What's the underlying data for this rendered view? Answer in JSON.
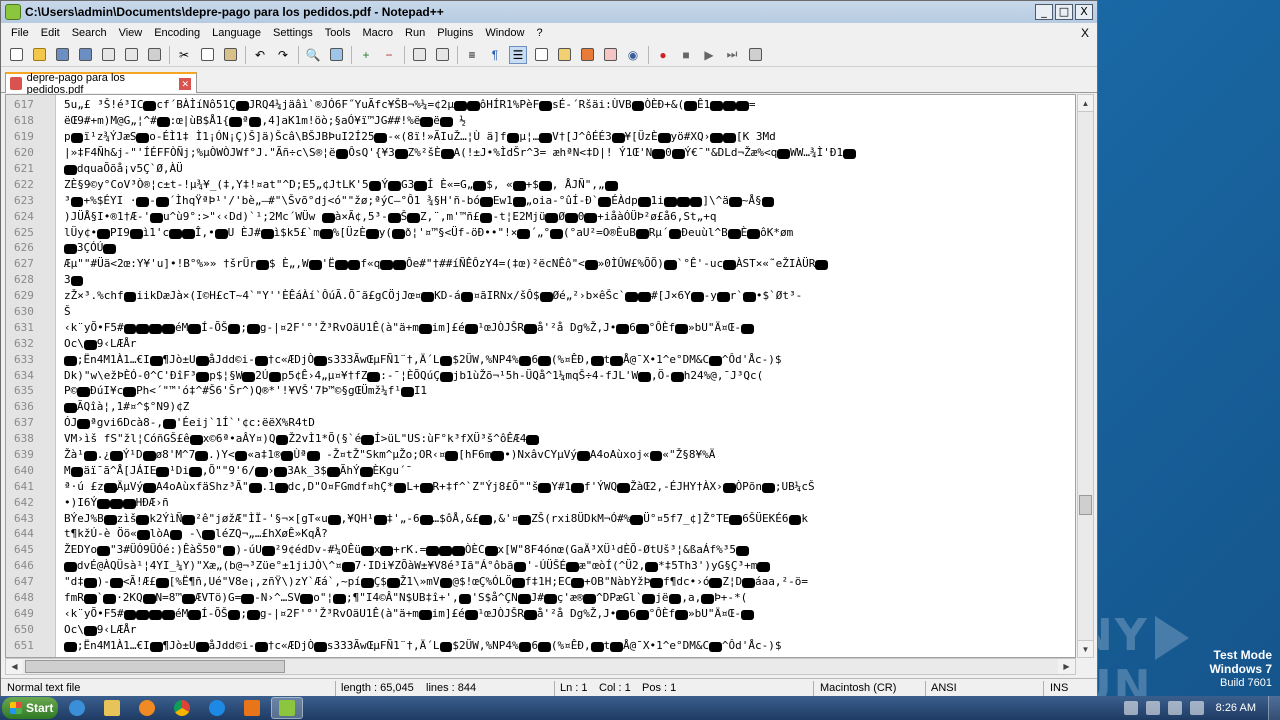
{
  "window": {
    "title": "C:\\Users\\admin\\Documents\\depre-pago para los pedidos.pdf - Notepad++",
    "minimize_glyph": "_",
    "maximize_glyph": "□",
    "close_glyph": "X"
  },
  "menu": {
    "items": [
      "File",
      "Edit",
      "Search",
      "View",
      "Encoding",
      "Language",
      "Settings",
      "Tools",
      "Macro",
      "Run",
      "Plugins",
      "Window",
      "?"
    ],
    "close_label": "X"
  },
  "toolbar": {
    "icons": [
      "new-file-icon",
      "open-file-icon",
      "save-icon",
      "save-all-icon",
      "close-icon",
      "close-all-icon",
      "print-icon",
      "cut-icon",
      "copy-icon",
      "paste-icon",
      "undo-icon",
      "redo-icon",
      "find-icon",
      "replace-icon",
      "zoom-in-icon",
      "zoom-out-icon",
      "sync-v-icon",
      "sync-h-icon",
      "word-wrap-icon",
      "show-all-chars-icon",
      "indent-guide-icon",
      "udl-icon",
      "doc-map-icon",
      "function-list-icon",
      "folder-workspace-icon",
      "monitor-icon",
      "record-macro-icon",
      "stop-macro-icon",
      "play-macro-icon",
      "play-multiple-icon",
      "save-macro-icon"
    ]
  },
  "tab": {
    "label": "depre-pago para los pedidos.pdf"
  },
  "editor": {
    "lines": [
      {
        "n": "617",
        "text": "5u„£ ³Š!é³IC▮cf´BÀÌíNô51Ç▮JRQ4¼jäâì`®JÓ6F˝YuÃfc¥ŠB¬%¼=¢2µ▮▮ôHÍR1%PèF▮sÉ-´Ršäi:ÙVB▮ÒÈÐ+&(▮Ê1▮▮▮="
      },
      {
        "n": "618",
        "text": "ëŒ9#+m)M@G„¦^#▮:œ|ùB$Å1{▮ª▮,4]aK1m!öò;§aÓ¥ï™JG##!%ë▮ë▮ ½"
      },
      {
        "n": "619",
        "text": "p▮ï¹z¾ÝJæS▮o-ÉÌ1‡ Ì1¡ÓN¡Ç)Š]ä)Šcâ\\BŠJBÞuI2Í25▮-«(8ï!»ÃIuŽ…¦Ù ä]f▮µ¦…▮V†[J^ôÉÉ3▮¥[ÜzÈ▮yö#XQ›▮▮[K 3Md"
      },
      {
        "n": "620",
        "text": "|»‡F4Ñh&j-\"'ÍÉFFÒÑj;%µÒWÒJWf°J.\"Ãñ÷c\\S®¦ë▮ÔsQ'{¥3▮Z%²šÈ▮A(!±J•%ÌdŠr^3= æhªN<‡D|! Ý1Œ'N▮0▮Ý€¯\"&DLd¬Žæ%<q▮WW…¾Ì'Ð1▮"
      },
      {
        "n": "621",
        "text": "▮dquaÕõå¡v5Ç`Ø,ÀÜ"
      },
      {
        "n": "622",
        "text": "ZÈ§9©y°CoV³Ò®¦c±t-!µ¾¥_(‡,Y‡!¤at\"^D;E5„¢JtLK'5▮Ý▮G3▮Í   È«=G„▮$, «▮+$▮, ÅJÑ\",„▮"
      },
      {
        "n": "623",
        "text": "³▮+%$ÉYI ·▮-▮´ÌhqŸªÞ¹'/'bè„—#\"\\Švõ°dj<ó\"\"žø;ªýC—°Ô1 ¾§H'ñ-bó▮Ew1▮„oia-°ûÍ-Ð`▮ÉÀdp▮1i▮▮▮]\\^ä▮~Å§▮"
      },
      {
        "n": "624",
        "text": ")JÜÅ§I•®1†Æ-'▮u^ù9°:>\"‹‹Dd)`¹;2Mc´WÜw ▮à×Ã¢,5³-▮Š▮Z,¨,m'™ñ£▮-t¦E2Mjü▮Ø▮0▮+iåàÓÜÞ²ø£å6,St„+q"
      },
      {
        "n": "625",
        "text": "lÜy¢•▮PI9▮ì1'c▮▮Î,•▮U   ЀJ#▮ì$k5£`m▮%[ÜzÈ▮y(▮ð¦'¤™§<Üf-öÐ••\"!×▮´„°▮(°aU²=O®ÈuB▮Rµ´▮Ðeuùl^B▮È▮ôK*øm"
      },
      {
        "n": "626",
        "text": "▮3ÇÓÚ▮"
      },
      {
        "n": "627",
        "text": "Æµ\"\"#Üä<2œ:Y¥'u]•!B°%»» †šrÜr▮$ È„,W▮'Ë▮▮f«q▮▮Ôe#\"†##íÑÊÔzY4=(‡œ)²ëcNÊô\"<▮»0ÌÛW£%ÕÕ)▮`°Ê'-uc▮ÀST×«˜eŽIÀÜR▮"
      },
      {
        "n": "628",
        "text": "3▮"
      },
      {
        "n": "629",
        "text": "zŽ×³.%chf▮iikDæJà×(I©H£cT~4`\"Y''ÈÊáÀí`ÔúÃ.Õ¯ã£gCÖjJœ¤▮KD-á▮¤ãIRNx/šÔ$▮Øé„²›b×êŠc`▮▮#[J×6Y▮-y▮r`▮•$`Øt³-"
      },
      {
        "n": "630",
        "text": "Š"
      },
      {
        "n": "631",
        "text": "‹k¨yÕ•F5#▮▮▮▮éM▮Í-ÕŠ▮;▮g-|¤2F'°'Ž³RvOäU1Ê(à\"ä+m▮im]£é▮¹œJÒJŠR▮å'²å Dg%Ž,J•▮6▮°ÔÈf▮»bU\"Ä¤Œ-▮"
      },
      {
        "n": "632",
        "text": "Oc\\▮9‹LÆÅr"
      },
      {
        "n": "633",
        "text": "▮;Ën4M1À1…€I▮¶Jò±U▮åJdd©i-▮†c«ÆDjÒ▮s333ÃwŒµFÑ1¨†,Ä´L▮$2ÜW,%NP4%▮6▮(%¤ÊÐ,▮t▮Å@¯X•1^e°DM&C▮^Ôd'Åc-)$"
      },
      {
        "n": "634",
        "text": "Dk)\"w\\ežÞÈÓ-0^C'ÐîF³▮p$¦§W▮2Ú▮p5¢Ê›4„µ¤¥†fZ▮:-¯¦ÈÕQúÇ▮jb1ùŽõ¬¹5h-ÜQå^1¼mqŠ÷4-fJL'W▮,Ö-▮h24%@,¯J³Qc("
      },
      {
        "n": "635",
        "text": "P©▮ÐúI¥c▮Ph<´\"™'ó‡^#Š6'Šr^)Q®*'!¥VŠ'7Þ™©§gŒÜmž¼f¹▮I1"
      },
      {
        "n": "636",
        "text": "▮ÃQîà¦,1#¤^$°N9)¢Z"
      },
      {
        "n": "637",
        "text": "ÓJ▮ªgvi6Dcà8-,▮'Éeij`1Í`'¢c:ëëX%R4tD"
      },
      {
        "n": "638",
        "text": "VM›ìš   fS\"žl¦CóñGŠ£ê▮x©6ª•aÂY¤)Q▮Ž2vÌ1*Õ(§`é▮Í>üL\"US:ùF°k³fXÜ³š^ôÊÆ4▮"
      },
      {
        "n": "639",
        "text": "Žà¹▮.¿▮Ý¹D▮ø8'M^7▮.)Y<▮«a‡1®▮Ùª▮   -Ž¤tŽ\"Skm^µŽo;OR‹¤▮[hF6m▮•)NxâvCYµVý▮A4oAùxoj«▮«\"Ž§8¥%Ä"
      },
      {
        "n": "640",
        "text": "M▮äï¯ã^Å[JÁIE▮¹Di▮,Õ\"\"9'6/▮›▮3Ak_3$▮ÃhÝ▮ÈKgu´¯"
      },
      {
        "n": "641",
        "text": "ª·ú £z▮ÄµVý▮A4oAùxfäShz³Ã\"▮.1▮dc,D\"O¤FGmdf¤hÇ*▮L+▮R+‡f^`Z\"Ýj8£Õ\"\"š▮Y#1▮f'ÝWQ▮ŽàŒ2,-ÉJHY†ÀX›▮ÒPõn▮;UB¼cŠ"
      },
      {
        "n": "642",
        "text": "•)I6Ý▮▮▮HÐÆ›ñ"
      },
      {
        "n": "643",
        "text": "BÝeJ%B▮zìš▮k2ÝìÑ▮²ê\"jøžÆ\"ÌÏ-'§¬×[gT«u▮,¥QH¹▮‡'„-6▮…$ôÅ,&£▮,&'¤▮ZŠ(rxi8ÜDkM¬Ó#%▮Ü°¤5f7_¢]Ž°TE▮6ŠÜEKÉ6▮k"
      },
      {
        "n": "644",
        "text": "t¶kžÚ-è Öö«▮lòA▮ -\\▮léZQ¬„…£hXøÊ»KqÅ?"
      },
      {
        "n": "645",
        "text": "ŽEDYo▮\"3#ÜÓ9ÜÓé:)ÊàŠ50\"▮)-úU▮²9¢édDv-#¼OÊü▮x▮+rK.=▮▮▮ÒÈC▮x[W\"8F4ónœ(GaÄ³XÜ¹dÈÕ-ØtUš³¦&ßaÁf%³5▮"
      },
      {
        "n": "646",
        "text": "▮dvÉ@ÀQÜsà¹¦4YI_¼Y)\"Xæ„(b@¬³Züe°±1jiJÒ\\^¤▮7·IDi¥ZÕàW±¥V8é³Iã\"Á°ôbã▮'-ÚÜŠÉ▮æ\"œòÍ(^Ü2,▮*‡5Th3')yG§Ç³+m▮"
      },
      {
        "n": "647",
        "text": "\"d‡▮)-▮<Ã!Æ£▮[%Ë¶ñ,Ué\"V8e¡,zñŸ\\)zY`Æá`,~pí▮Ç$▮Ž1\\»mV▮@$!œÇ%ÓLÖ▮f‡1H;EC▮+OB\"NàbYžÞ▮f¶dc•›ó▮Z¦D▮áaa,²-ö="
      },
      {
        "n": "648",
        "text": "fmR▮`▮·2KQ▮N=8™▮ÆVTö)G=▮-N›^…SV▮o\"¦▮;¶\"I4©Â\"N$UB‡î+',▮'S$å^ÇN▮J#▮ç'æ®▮^DPæGl`▮jë▮,a,▮Þ+-*("
      },
      {
        "n": "649",
        "text": "‹k¨yÕ•F5#▮▮▮▮éM▮Í-ÕŠ▮;▮g-|¤2F'°'Ž³RvOäU1Ê(à\"ä+m▮im]£é▮¹œJÒJŠR▮å'²å Dg%Ž,J•▮6▮°ÔÈf▮»bU\"Ä¤Œ-▮"
      },
      {
        "n": "650",
        "text": "Oc\\▮9‹LÆÅr"
      },
      {
        "n": "651",
        "text": "▮;Ën4M1À1…€I▮¶Jò±U▮åJdd©i-▮†c«ÆDjÒ▮s333ÃwŒµFÑ1¨†,Ä´L▮$2ÜW,%NP4%▮6▮(%¤ÊÐ,▮t▮Å@¯X•1^e°DM&C▮^Ôd'Åc-)$"
      }
    ]
  },
  "status": {
    "file_type": "Normal text file",
    "length": "length : 65,045",
    "lines": "lines : 844",
    "ln": "Ln : 1",
    "col": "Col : 1",
    "pos": "Pos : 1",
    "eol": "Macintosh (CR)",
    "encoding": "ANSI",
    "mode": "INS"
  },
  "desktop": {
    "watermark_left": "ANY",
    "watermark_right": "RUN",
    "test_mode": "Test Mode",
    "os_name": "Windows 7",
    "build": "Build 7601"
  },
  "taskbar": {
    "start_label": "Start",
    "clock": "8:26 AM"
  }
}
